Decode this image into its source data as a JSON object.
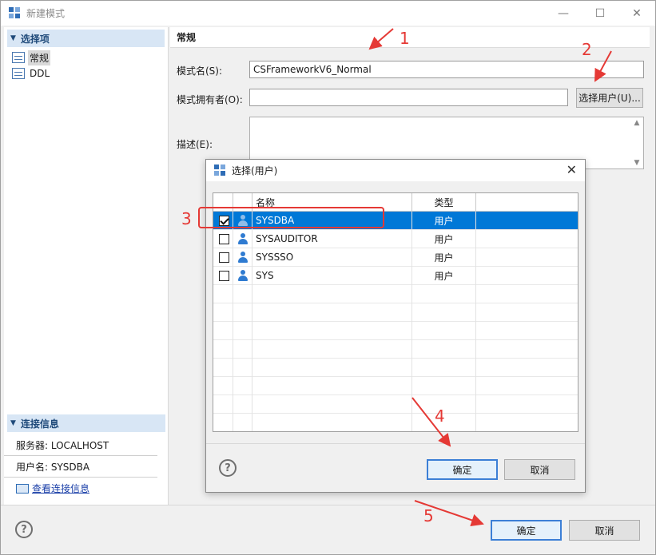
{
  "window": {
    "title": "新建模式",
    "controls": {
      "minimize": "—",
      "maximize": "☐",
      "close": "✕"
    }
  },
  "left_pane": {
    "section_header": "选择项",
    "nav_items": [
      {
        "label": "常规",
        "selected": true
      },
      {
        "label": "DDL",
        "selected": false
      }
    ],
    "connection_header": "连接信息",
    "server_label": "服务器: LOCALHOST",
    "user_label": "用户名: SYSDBA",
    "view_link": "查看连接信息"
  },
  "main": {
    "section_title": "常规",
    "schema_name_label": "模式名(S):",
    "schema_name_value": "CSFrameworkV6_Normal",
    "owner_label": "模式拥有者(O):",
    "owner_value": "",
    "select_user_button": "选择用户(U)...",
    "description_label": "描述(E):",
    "description_value": ""
  },
  "footer": {
    "help": "?",
    "ok_button": "确定",
    "cancel_button": "取消"
  },
  "dialog": {
    "title": "选择(用户)",
    "close": "✕",
    "columns": [
      "名称",
      "类型"
    ],
    "rows": [
      {
        "name": "SYSDBA",
        "type": "用户",
        "checked": true,
        "selected": true
      },
      {
        "name": "SYSAUDITOR",
        "type": "用户",
        "checked": false,
        "selected": false
      },
      {
        "name": "SYSSSO",
        "type": "用户",
        "checked": false,
        "selected": false
      },
      {
        "name": "SYS",
        "type": "用户",
        "checked": false,
        "selected": false
      }
    ],
    "help": "?",
    "ok_button": "确定",
    "cancel_button": "取消"
  },
  "annotations": {
    "color": "#e53935",
    "numbers": [
      "1",
      "2",
      "3",
      "4",
      "5"
    ]
  },
  "colors": {
    "selection": "#0078d7",
    "header_bg": "#d8e6f5",
    "user_icon": "#2f7bd1"
  }
}
